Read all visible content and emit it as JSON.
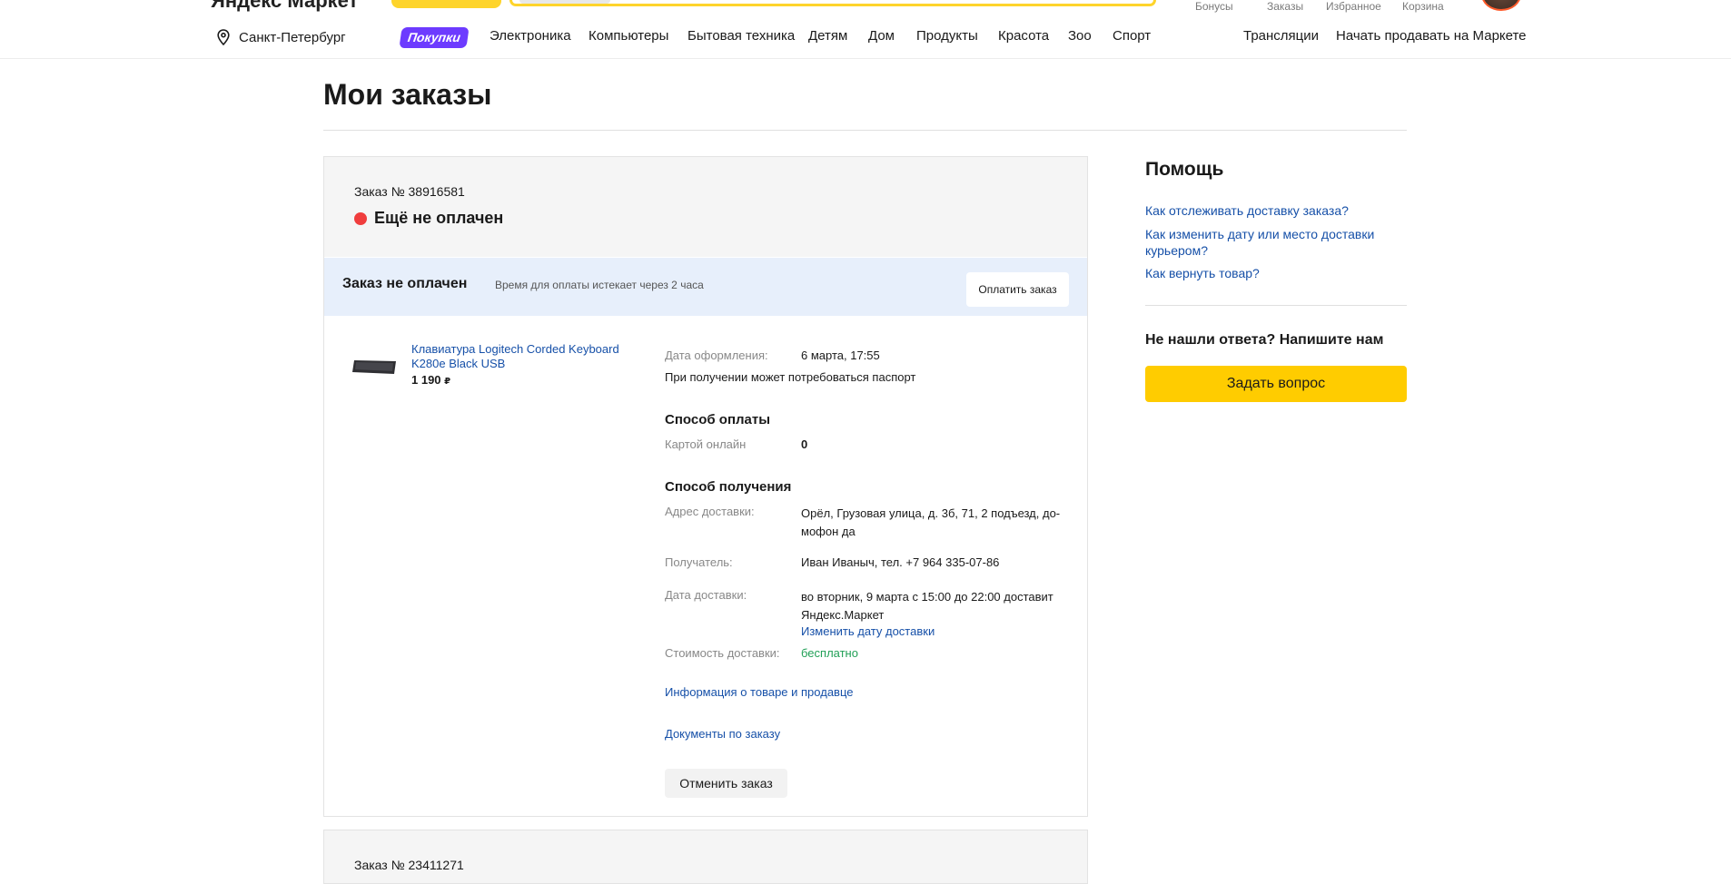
{
  "header": {
    "logo_fragment": "Яндекс Маркет",
    "user_links": [
      "Бонусы",
      "Заказы",
      "Избранное",
      "Корзина"
    ],
    "region": "Санкт-Петербург",
    "promo_badge": "Покупки",
    "categories": [
      "Электроника",
      "Компьютеры",
      "Бытовая техника",
      "Детям",
      "Дом",
      "Продукты",
      "Красота",
      "Зоо",
      "Спорт"
    ],
    "right_links": [
      "Трансляции",
      "Начать продавать на Маркете"
    ]
  },
  "page_title": "Мои заказы",
  "order": {
    "number_label": "Заказ № 38916581",
    "status": "Ещё не оплачен",
    "unpaid_title": "Заказ не оплачен",
    "unpaid_note": "Время для оплаты истекает через 2 часа",
    "pay_button": "Оплатить заказ",
    "product": {
      "name": "Клавиатура Logitech Corded Keyboard K280e Black USB",
      "price": "1 190",
      "currency": "₽"
    },
    "order_date_label": "Дата оформления:",
    "order_date": "6 марта, 17:55",
    "passport_note": "При получении может потребоваться паспорт",
    "payment_title": "Способ оплаты",
    "payment_method": "Картой онлайн",
    "payment_value": "0",
    "delivery_title": "Способ получения",
    "address_label": "Адрес доставки:",
    "address": "Орёл, Грузовая улица, д. 3б, 71, 2 подъезд, до-мофон да",
    "recipient_label": "Получатель:",
    "recipient": "Иван Иваныч, тел. +7 964 335-07-86",
    "delivery_date_label": "Дата доставки:",
    "delivery_date": "во вторник, 9 марта с 15:00 до 22:00 доставит Яндекс.Маркет",
    "change_date_link": "Изменить дату доставки",
    "delivery_cost_label": "Стоимость доставки:",
    "delivery_cost": "бесплатно",
    "seller_info_link": "Информация о товаре и продавце",
    "documents_link": "Документы по заказу",
    "cancel_button": "Отменить заказ"
  },
  "next_order": {
    "number_label": "Заказ № 23411271"
  },
  "help": {
    "title": "Помощь",
    "links": [
      "Как отслеживать доставку заказа?",
      "Как изменить дату или место доставки курьером?",
      "Как вернуть товар?"
    ],
    "subtitle": "Не нашли ответа? Напишите нам",
    "ask_button": "Задать вопрос"
  },
  "colors": {
    "accent_yellow": "#ffcc00",
    "link_blue": "#1650a8",
    "status_red": "#f03d3d",
    "promo_purple": "#6d3bff",
    "free_green": "#22a057"
  }
}
